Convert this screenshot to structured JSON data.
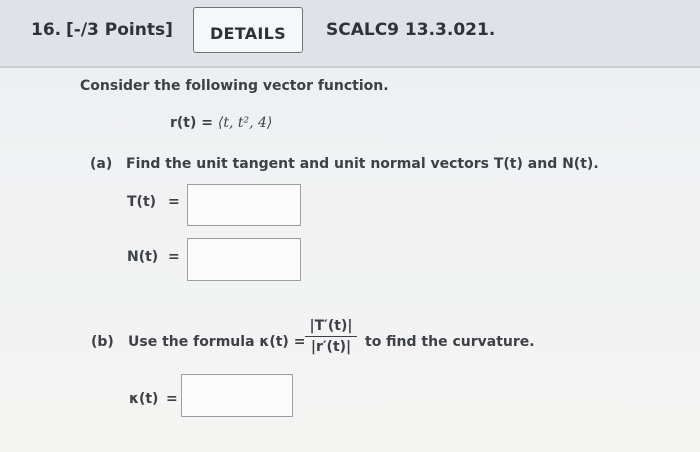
{
  "header": {
    "question_number": "16.",
    "points": "[-/3 Points]",
    "details_label": "DETAILS",
    "problem_code": "SCALC9 13.3.021."
  },
  "problem": {
    "intro": "Consider the following vector function.",
    "function": {
      "lhs": "r(t)",
      "eq": "=",
      "rhs": "⟨t, t², 4⟩"
    },
    "part_a": {
      "label": "(a)",
      "text_pre": "Find the unit tangent and unit normal vectors ",
      "T": "T(t)",
      "and": " and ",
      "N": "N(t)",
      "end": ".",
      "fields": [
        {
          "label": "T(t)",
          "eq": "=",
          "value": ""
        },
        {
          "label": "N(t)",
          "eq": "=",
          "value": ""
        }
      ]
    },
    "part_b": {
      "label": "(b)",
      "text_pre": "Use the formula κ(t) =",
      "numerator": "|T′(t)|",
      "denominator": "|r′(t)|",
      "text_post": "to find the curvature.",
      "field": {
        "label": "κ(t)",
        "eq": "=",
        "value": ""
      }
    }
  }
}
